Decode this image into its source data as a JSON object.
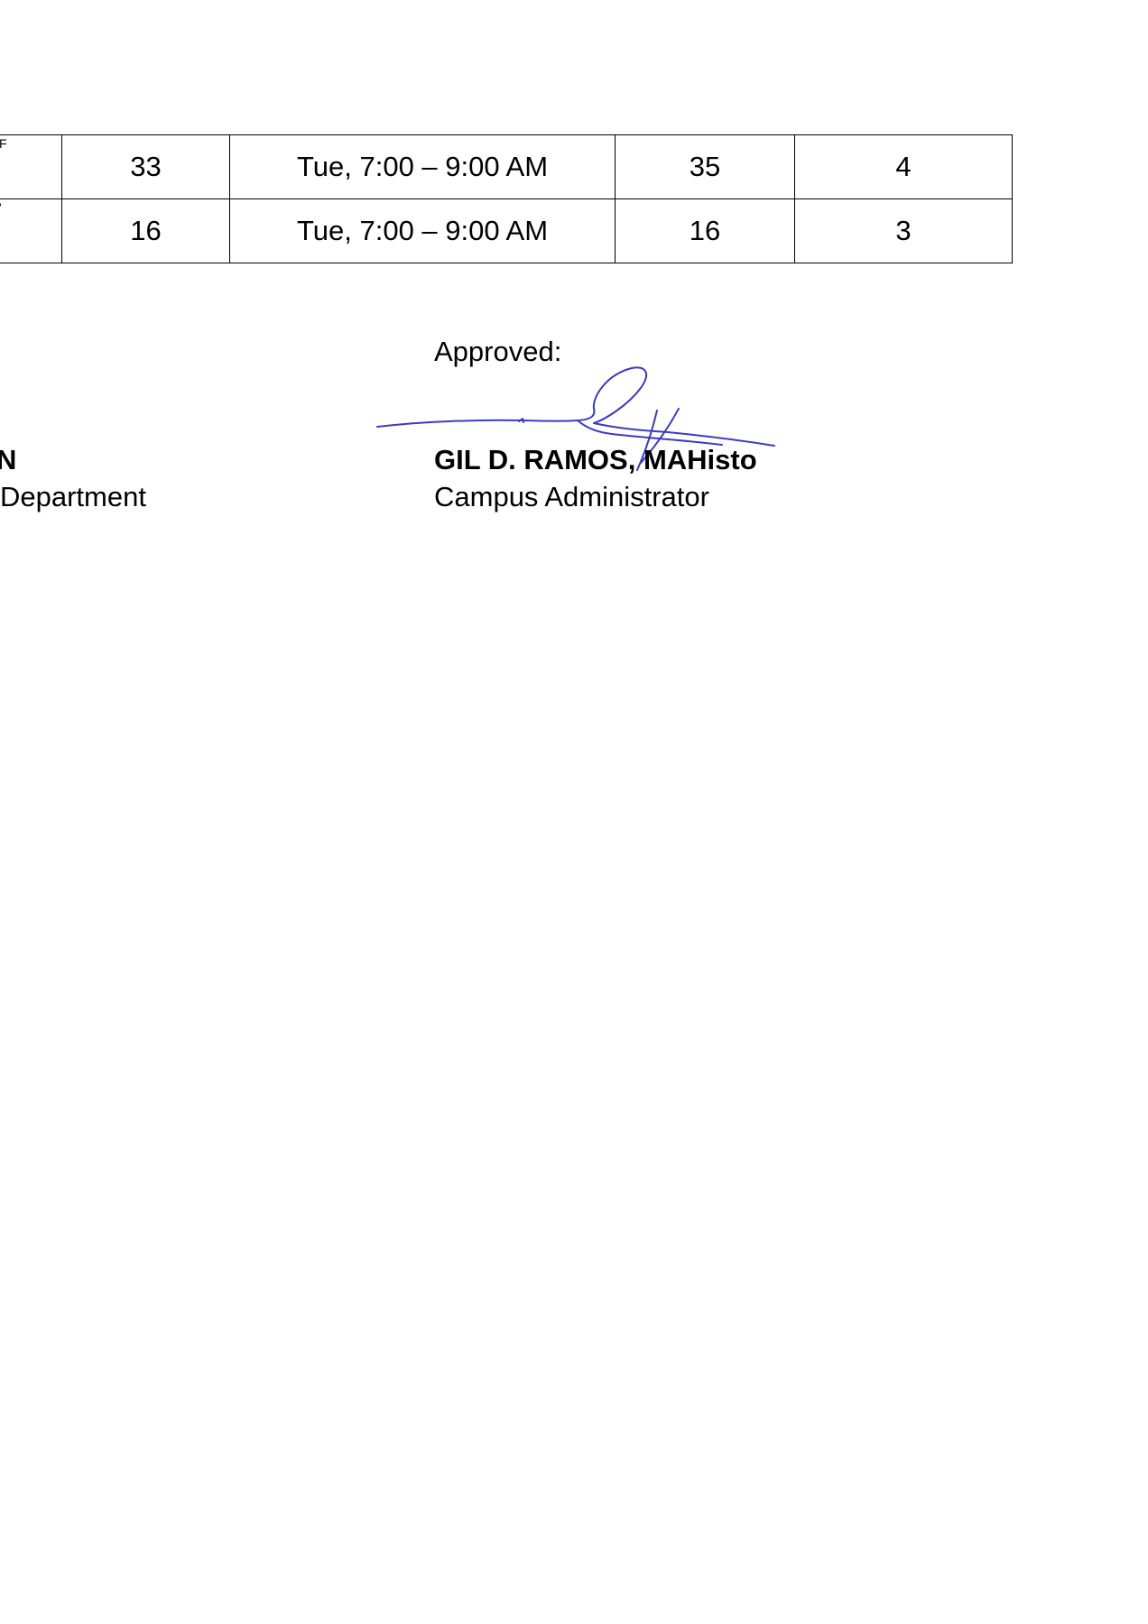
{
  "table": {
    "rows": [
      {
        "edge_mark": "F",
        "c1": "33",
        "schedule": "Tue, 7:00 – 9:00 AM",
        "c3": "35",
        "c4": "4"
      },
      {
        "edge_mark": "'",
        "c1": "16",
        "schedule": "Tue, 7:00 – 9:00 AM",
        "c3": "16",
        "c4": "3"
      }
    ]
  },
  "signatories": {
    "approved_label": "Approved:",
    "left": {
      "name": "N",
      "title": "Department"
    },
    "right": {
      "name": "GIL D. RAMOS, MAHisto",
      "title": "Campus Administrator"
    }
  },
  "colors": {
    "signature_ink": "#3b3bc4",
    "text": "#000000",
    "border": "#000000"
  }
}
